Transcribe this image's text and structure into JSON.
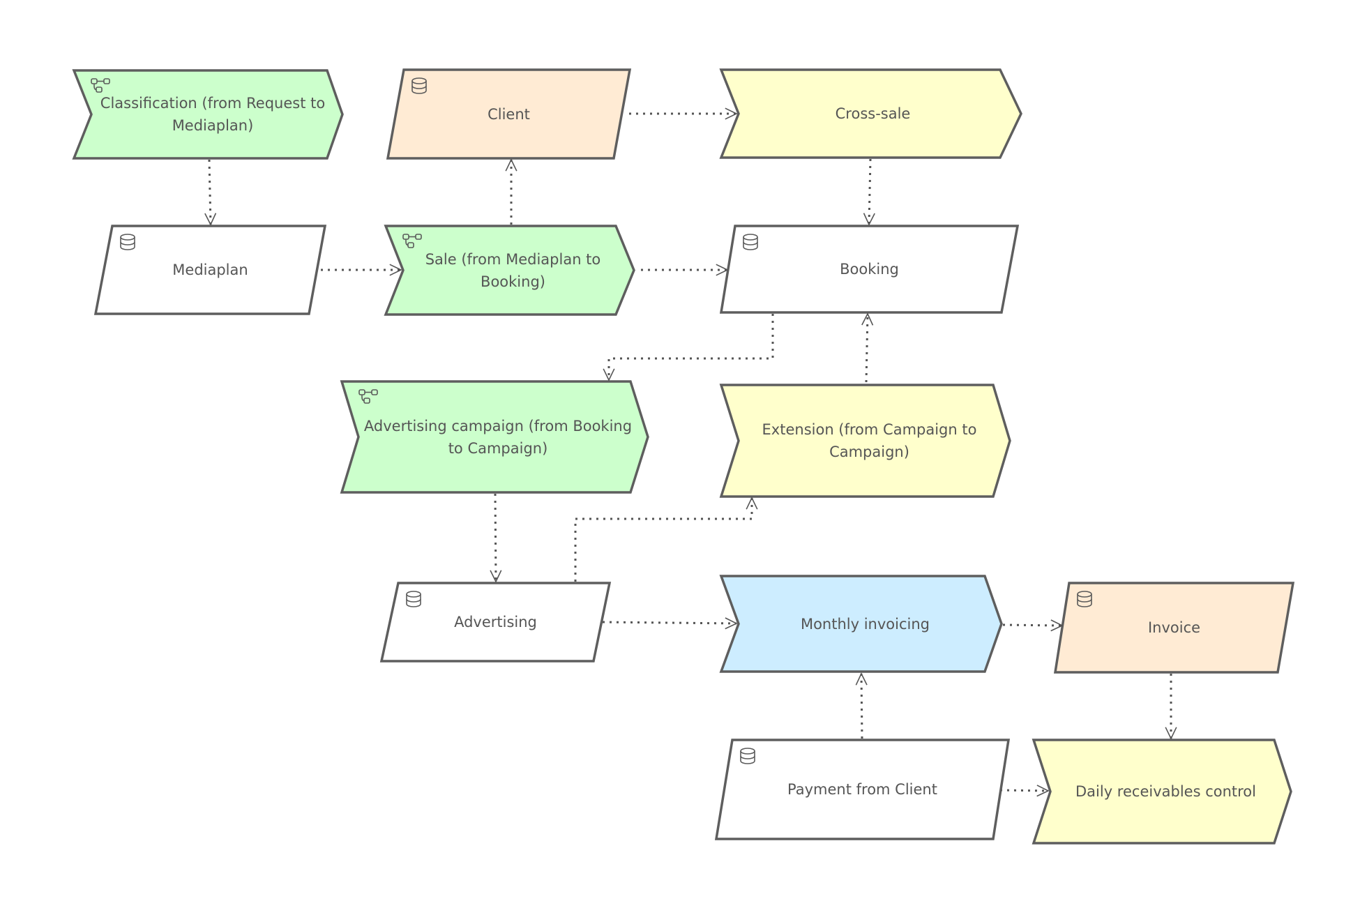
{
  "diagram": {
    "type": "process-data-flow",
    "colors": {
      "process": "#ccffcc",
      "data_highlight": "#ffebd4",
      "function": "#ffffcc",
      "function_highlight": "#cdedff",
      "data": "#ffffff",
      "stroke": "#5e5e5e",
      "text": "#555555"
    },
    "nodes": [
      {
        "id": "classification",
        "label": "Classification (from Request to Mediaplan)",
        "kind": "process",
        "icon": "process-icon",
        "fill": "#ccffcc"
      },
      {
        "id": "client",
        "label": "Client",
        "kind": "data",
        "icon": "database-icon",
        "fill": "#ffebd4"
      },
      {
        "id": "cross_sale",
        "label": "Cross-sale",
        "kind": "function",
        "icon": null,
        "fill": "#ffffcc"
      },
      {
        "id": "mediaplan",
        "label": "Mediaplan",
        "kind": "data",
        "icon": "database-icon",
        "fill": "#ffffff"
      },
      {
        "id": "sale",
        "label": "Sale (from Mediaplan to Booking)",
        "kind": "process",
        "icon": "process-icon",
        "fill": "#ccffcc"
      },
      {
        "id": "booking",
        "label": "Booking",
        "kind": "data",
        "icon": "database-icon",
        "fill": "#ffffff"
      },
      {
        "id": "adv_campaign",
        "label": "Advertising campaign (from Booking to Campaign)",
        "kind": "process",
        "icon": "process-icon",
        "fill": "#ccffcc"
      },
      {
        "id": "extension",
        "label": "Extension (from Campaign to Campaign)",
        "kind": "function",
        "icon": null,
        "fill": "#ffffcc"
      },
      {
        "id": "advertising",
        "label": "Advertising",
        "kind": "data",
        "icon": "database-icon",
        "fill": "#ffffff"
      },
      {
        "id": "monthly_invoicing",
        "label": "Monthly invoicing",
        "kind": "function",
        "icon": null,
        "fill": "#cdedff"
      },
      {
        "id": "invoice",
        "label": "Invoice",
        "kind": "data",
        "icon": "database-icon",
        "fill": "#ffebd4"
      },
      {
        "id": "payment",
        "label": "Payment from Client",
        "kind": "data",
        "icon": "database-icon",
        "fill": "#ffffff"
      },
      {
        "id": "daily_receivables",
        "label": "Daily receivables control",
        "kind": "function",
        "icon": null,
        "fill": "#ffffcc"
      }
    ],
    "edges": [
      {
        "from": "classification",
        "to": "mediaplan",
        "style": "dotted"
      },
      {
        "from": "client",
        "to": "cross_sale",
        "style": "dotted"
      },
      {
        "from": "cross_sale",
        "to": "booking",
        "style": "dotted"
      },
      {
        "from": "mediaplan",
        "to": "sale",
        "style": "dotted"
      },
      {
        "from": "sale",
        "to": "client",
        "style": "dotted"
      },
      {
        "from": "sale",
        "to": "booking",
        "style": "dotted"
      },
      {
        "from": "booking",
        "to": "adv_campaign",
        "style": "dotted"
      },
      {
        "from": "extension",
        "to": "booking",
        "style": "dotted"
      },
      {
        "from": "adv_campaign",
        "to": "advertising",
        "style": "dotted"
      },
      {
        "from": "advertising",
        "to": "extension",
        "style": "dotted"
      },
      {
        "from": "advertising",
        "to": "monthly_invoicing",
        "style": "dotted"
      },
      {
        "from": "monthly_invoicing",
        "to": "invoice",
        "style": "dotted"
      },
      {
        "from": "payment",
        "to": "monthly_invoicing",
        "style": "dotted"
      },
      {
        "from": "invoice",
        "to": "daily_receivables",
        "style": "dotted"
      },
      {
        "from": "payment",
        "to": "daily_receivables",
        "style": "dotted"
      }
    ]
  }
}
